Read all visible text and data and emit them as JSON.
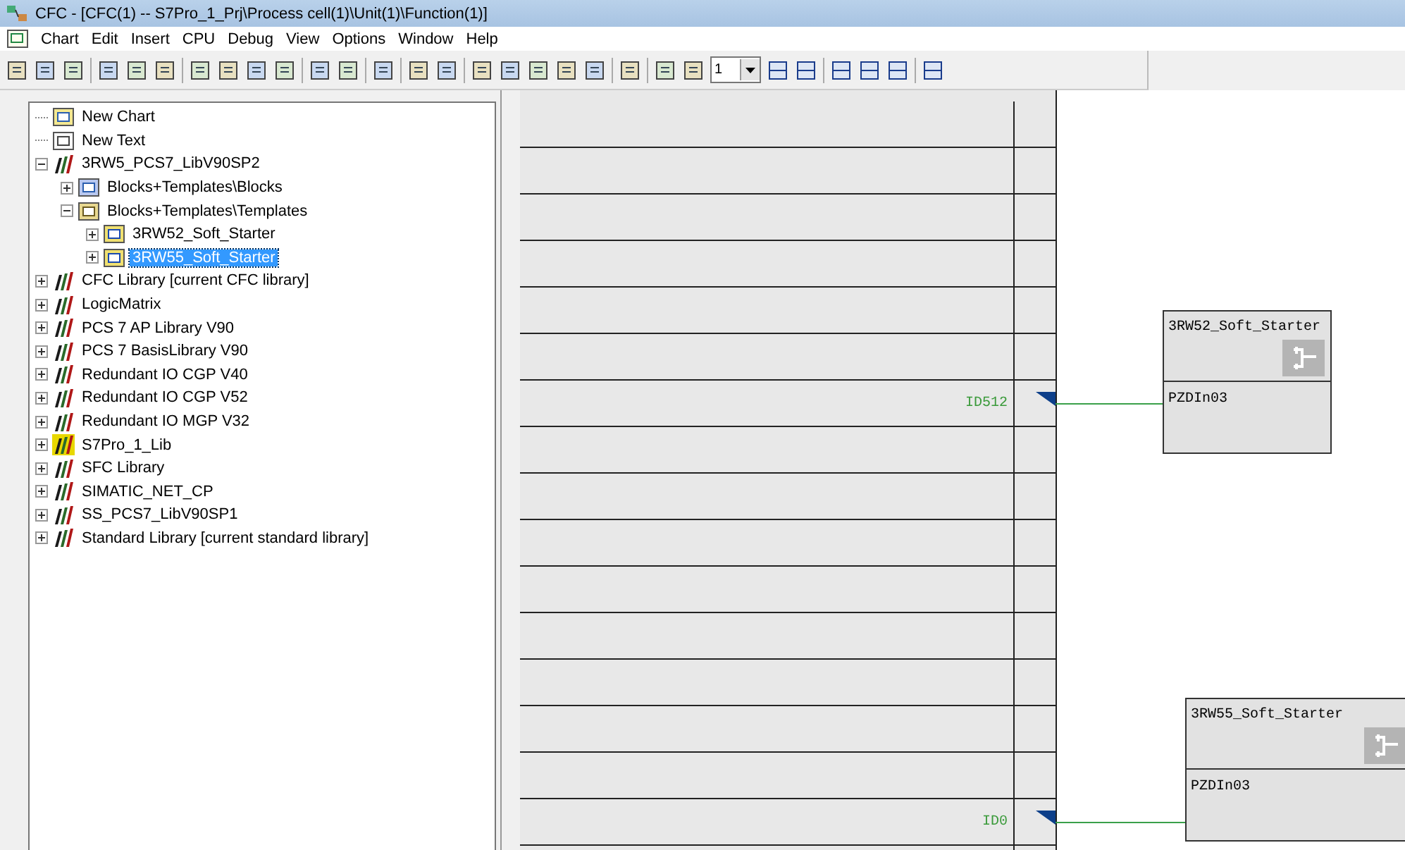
{
  "window": {
    "title": "CFC - [CFC(1) -- S7Pro_1_Prj\\Process cell(1)\\Unit(1)\\Function(1)]"
  },
  "menu": [
    "Chart",
    "Edit",
    "Insert",
    "CPU",
    "Debug",
    "View",
    "Options",
    "Window",
    "Help"
  ],
  "toolbar": {
    "zoom_box": "1"
  },
  "tree": [
    {
      "label": "New Chart",
      "kind": "chart",
      "selected": false
    },
    {
      "label": "New Text",
      "kind": "text",
      "selected": false
    },
    {
      "label": "3RW5_PCS7_LibV90SP2",
      "kind": "library",
      "selected": false,
      "expanded": true,
      "children": [
        {
          "label": "Blocks+Templates\\Blocks",
          "kind": "blocks",
          "selected": false,
          "expanded": false
        },
        {
          "label": "Blocks+Templates\\Templates",
          "kind": "templates",
          "selected": false,
          "expanded": true,
          "children": [
            {
              "label": "3RW52_Soft_Starter",
              "kind": "template",
              "selected": false,
              "expanded": false
            },
            {
              "label": "3RW55_Soft_Starter",
              "kind": "template",
              "selected": true,
              "expanded": false
            }
          ]
        }
      ]
    },
    {
      "label": "CFC Library  [current CFC library]",
      "kind": "library",
      "selected": false,
      "expanded": false
    },
    {
      "label": "LogicMatrix",
      "kind": "library",
      "selected": false,
      "expanded": false
    },
    {
      "label": "PCS 7 AP Library V90",
      "kind": "library",
      "selected": false,
      "expanded": false
    },
    {
      "label": "PCS 7 BasisLibrary V90",
      "kind": "library",
      "selected": false,
      "expanded": false
    },
    {
      "label": "Redundant IO CGP V40",
      "kind": "library",
      "selected": false,
      "expanded": false
    },
    {
      "label": "Redundant IO CGP V52",
      "kind": "library",
      "selected": false,
      "expanded": false
    },
    {
      "label": "Redundant IO MGP V32",
      "kind": "library",
      "selected": false,
      "expanded": false
    },
    {
      "label": "S7Pro_1_Lib",
      "kind": "project-library",
      "selected": false,
      "expanded": false
    },
    {
      "label": "SFC Library",
      "kind": "library",
      "selected": false,
      "expanded": false
    },
    {
      "label": "SIMATIC_NET_CP",
      "kind": "library",
      "selected": false,
      "expanded": false
    },
    {
      "label": "SS_PCS7_LibV90SP1",
      "kind": "library",
      "selected": false,
      "expanded": false
    },
    {
      "label": "Standard Library  [current standard library]",
      "kind": "library",
      "selected": false,
      "expanded": false
    }
  ],
  "chart": {
    "blocks": [
      {
        "name": "3RW52_Soft_Starter",
        "input": "PZDIn03",
        "sheet_bar_label": "ID512"
      },
      {
        "name": "3RW55_Soft_Starter",
        "input": "PZDIn03",
        "sheet_bar_label": "ID0"
      }
    ]
  }
}
